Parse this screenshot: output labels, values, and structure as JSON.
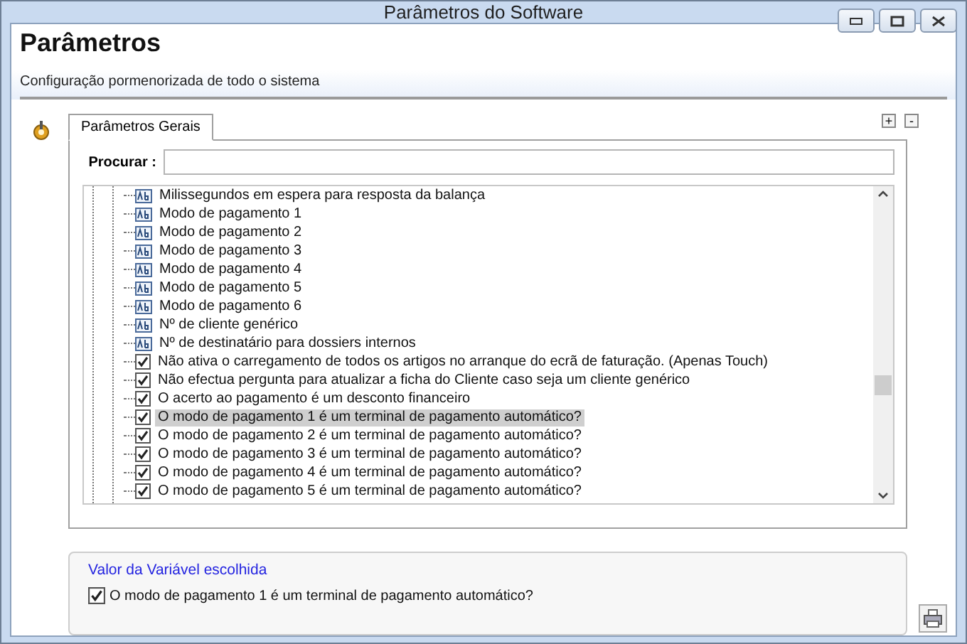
{
  "window": {
    "title": "Parâmetros do Software"
  },
  "header": {
    "title": "Parâmetros",
    "subtitle": "Configuração pormenorizada de todo o sistema"
  },
  "tabs": [
    {
      "label": "Parâmetros Gerais",
      "selected": true
    }
  ],
  "tab_buttons": [
    "+",
    "-"
  ],
  "search": {
    "label": "Procurar :"
  },
  "tree": [
    {
      "kind": "text",
      "label": "Milissegundos em espera para resposta da balança",
      "selected": false
    },
    {
      "kind": "text",
      "label": "Modo de pagamento 1",
      "selected": false
    },
    {
      "kind": "text",
      "label": "Modo de pagamento 2",
      "selected": false
    },
    {
      "kind": "text",
      "label": "Modo de pagamento 3",
      "selected": false
    },
    {
      "kind": "text",
      "label": "Modo de pagamento 4",
      "selected": false
    },
    {
      "kind": "text",
      "label": "Modo de pagamento 5",
      "selected": false
    },
    {
      "kind": "text",
      "label": "Modo de pagamento 6",
      "selected": false
    },
    {
      "kind": "text",
      "label": "Nº de cliente genérico",
      "selected": false
    },
    {
      "kind": "text",
      "label": "Nº de destinatário para dossiers internos",
      "selected": false
    },
    {
      "kind": "checkbox",
      "checked": true,
      "label": "Não ativa o carregamento de todos os artigos no arranque do ecrã de faturação. (Apenas Touch)",
      "selected": false
    },
    {
      "kind": "checkbox",
      "checked": true,
      "label": "Não efectua pergunta para atualizar a ficha do Cliente caso seja um cliente genérico",
      "selected": false
    },
    {
      "kind": "checkbox",
      "checked": true,
      "label": "O acerto ao pagamento é um desconto financeiro",
      "selected": false
    },
    {
      "kind": "checkbox",
      "checked": true,
      "label": "O modo de pagamento 1 é um terminal de pagamento automático?",
      "selected": true
    },
    {
      "kind": "checkbox",
      "checked": true,
      "label": "O modo de pagamento 2 é um terminal de pagamento automático?",
      "selected": false
    },
    {
      "kind": "checkbox",
      "checked": true,
      "label": "O modo de pagamento 3 é um terminal de pagamento automático?",
      "selected": false
    },
    {
      "kind": "checkbox",
      "checked": true,
      "label": "O modo de pagamento 4 é um terminal de pagamento automático?",
      "selected": false
    },
    {
      "kind": "checkbox",
      "checked": true,
      "label": "O modo de pagamento 5 é um terminal de pagamento automático?",
      "selected": false
    }
  ],
  "value_panel": {
    "title": "Valor da Variável escolhida",
    "checkbox": {
      "label": "O modo de pagamento 1 é um terminal de pagamento automático?",
      "checked": true
    }
  }
}
